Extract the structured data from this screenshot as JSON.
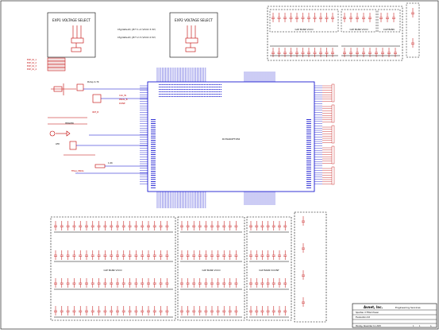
{
  "colors": {
    "wire": "#0000cc",
    "part": "#c00000",
    "frame": "#000000",
    "net_label": "#c00000",
    "note": "#000000"
  },
  "exp1_block": {
    "title": "EXP1 VOLTAGE SELECT",
    "notes": [
      "Cfg(default): JP?? 1-2 (VCCO 3.3V)",
      "Cfg(default): JP?? 2-3 (VCCO 2.5V)"
    ]
  },
  "exp2_block": {
    "title": "EXP2 VOLTAGE SELECT"
  },
  "left_nets": [
    "EXP_IO_1",
    "EXP_IO_2",
    "EXP_IO_3",
    "EXP_IO_4"
  ],
  "left_components": [
    {
      "ref": "R201",
      "note": "Pullup 4.7K"
    },
    {
      "ref": "U?",
      "note": "OSC"
    },
    {
      "ref": "JP?",
      "note": "HEADER"
    },
    {
      "ref": "D?",
      "note": "LED"
    },
    {
      "ref": "Q?",
      "note": "FET"
    },
    {
      "ref": "R?",
      "note": "1.0K"
    }
  ],
  "left_net_labels": [
    "CLK_IN",
    "PROG_B",
    "DONE",
    "INIT_B"
  ],
  "fpga": {
    "part": "XC3S400FT256",
    "bottom_label": "FPGA_PROG"
  },
  "bypass_blocks": [
    {
      "name": "top_caps",
      "caption": "CAP BANK VCCO"
    },
    {
      "name": "top_caps_2",
      "caption": "CAP BANK VCCO"
    },
    {
      "name": "top_caps_3",
      "caption": "CAP BANK"
    },
    {
      "name": "bottom_caps_1",
      "caption": "CAP BANK VCCO"
    },
    {
      "name": "bottom_caps_2",
      "caption": "CAP BANK VCCO"
    },
    {
      "name": "bottom_caps_3",
      "caption": "CAP BANK VCCINT"
    }
  ],
  "title_block": {
    "company": "Avnet, Inc.",
    "department": "Engineering Services",
    "title": "Spartan-3 FPGA Power",
    "project": "Evaluation Kit",
    "sheet": "1",
    "of": "1",
    "rev": "A",
    "date": "Monday, November 14, 2005"
  }
}
